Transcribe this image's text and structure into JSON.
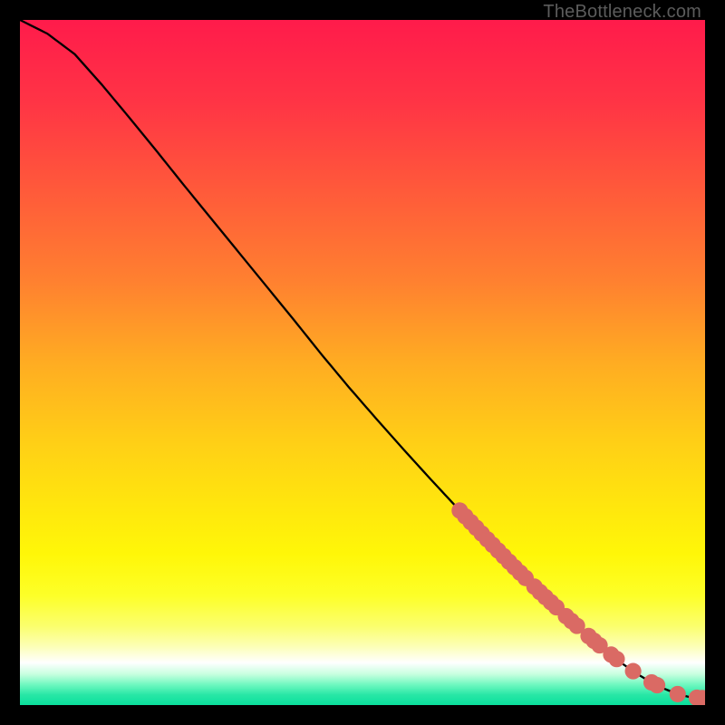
{
  "watermark": "TheBottleneck.com",
  "gradient": {
    "stops": [
      {
        "offset": 0.0,
        "color": "#ff1b4b"
      },
      {
        "offset": 0.12,
        "color": "#ff3445"
      },
      {
        "offset": 0.25,
        "color": "#ff5a3a"
      },
      {
        "offset": 0.38,
        "color": "#ff8030"
      },
      {
        "offset": 0.5,
        "color": "#ffac22"
      },
      {
        "offset": 0.62,
        "color": "#ffd016"
      },
      {
        "offset": 0.7,
        "color": "#ffe40e"
      },
      {
        "offset": 0.78,
        "color": "#fff708"
      },
      {
        "offset": 0.84,
        "color": "#fdff28"
      },
      {
        "offset": 0.885,
        "color": "#fbff6d"
      },
      {
        "offset": 0.915,
        "color": "#fcffb8"
      },
      {
        "offset": 0.938,
        "color": "#ffffff"
      },
      {
        "offset": 0.955,
        "color": "#c7ffdf"
      },
      {
        "offset": 0.97,
        "color": "#70f8c0"
      },
      {
        "offset": 0.985,
        "color": "#28e7a6"
      },
      {
        "offset": 1.0,
        "color": "#0adf9c"
      }
    ]
  },
  "chart_data": {
    "type": "line",
    "x": [
      0.0,
      0.04,
      0.08,
      0.12,
      0.16,
      0.2,
      0.24,
      0.28,
      0.32,
      0.36,
      0.4,
      0.44,
      0.48,
      0.52,
      0.56,
      0.6,
      0.64,
      0.68,
      0.72,
      0.76,
      0.8,
      0.84,
      0.88,
      0.9,
      0.92,
      0.94,
      0.96,
      0.98,
      1.0
    ],
    "values": [
      1.0,
      0.98,
      0.95,
      0.905,
      0.857,
      0.808,
      0.758,
      0.709,
      0.66,
      0.611,
      0.562,
      0.512,
      0.464,
      0.418,
      0.373,
      0.329,
      0.286,
      0.244,
      0.203,
      0.164,
      0.127,
      0.092,
      0.06,
      0.046,
      0.034,
      0.024,
      0.016,
      0.011,
      0.01
    ],
    "title": "",
    "xlabel": "",
    "ylabel": "",
    "xlim": [
      0,
      1
    ],
    "ylim": [
      0,
      1
    ],
    "markers_x": [
      0.642,
      0.65,
      0.658,
      0.666,
      0.674,
      0.682,
      0.69,
      0.698,
      0.706,
      0.714,
      0.722,
      0.73,
      0.738,
      0.751,
      0.759,
      0.767,
      0.775,
      0.783,
      0.797,
      0.805,
      0.813,
      0.83,
      0.838,
      0.846,
      0.863,
      0.871,
      0.895,
      0.922,
      0.93,
      0.96,
      0.988,
      0.996
    ],
    "markers_radius": 0.012,
    "marker_color": "#da6a64"
  }
}
